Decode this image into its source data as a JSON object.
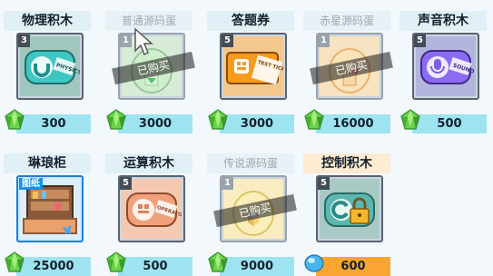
{
  "currency_icon": "green-gem-icon",
  "colors": {
    "price_bar": "#9de3f0",
    "price_bar_highlight": "#f8a531",
    "title_bg": "#e1eff7"
  },
  "items": [
    {
      "name": "物理积木",
      "count": "3",
      "price": "300",
      "owned": false,
      "icon": "physics-block-icon",
      "card_text": "PHYSICS"
    },
    {
      "name": "普通源码蛋",
      "count": "1",
      "price": "3000",
      "owned": true,
      "icon": "common-code-egg-icon",
      "bought_label": "已购买"
    },
    {
      "name": "答题券",
      "count": "5",
      "price": "3000",
      "owned": false,
      "icon": "quiz-ticket-icon",
      "card_text": "TEST TICKET"
    },
    {
      "name": "赤星源码蛋",
      "count": "1",
      "price": "16000",
      "owned": true,
      "icon": "red-star-code-egg-icon",
      "bought_label": "已购买"
    },
    {
      "name": "声音积木",
      "count": "5",
      "price": "500",
      "owned": false,
      "icon": "sound-block-icon",
      "card_text": "SOUND"
    },
    {
      "name": "琳琅柜",
      "badge": "图纸",
      "price": "25000",
      "owned": false,
      "icon": "shelf-cabinet-icon"
    },
    {
      "name": "运算积木",
      "count": "5",
      "price": "500",
      "owned": false,
      "icon": "operator-block-icon",
      "card_text": "OPERATO"
    },
    {
      "name": "传说源码蛋",
      "count": "1",
      "price": "9000",
      "owned": true,
      "icon": "legend-code-egg-icon",
      "bought_label": "已购买"
    },
    {
      "name": "控制积木",
      "count": "5",
      "price": "600",
      "owned": false,
      "icon": "control-block-locked-icon",
      "currency_icon": "blue-diamond-icon"
    }
  ]
}
